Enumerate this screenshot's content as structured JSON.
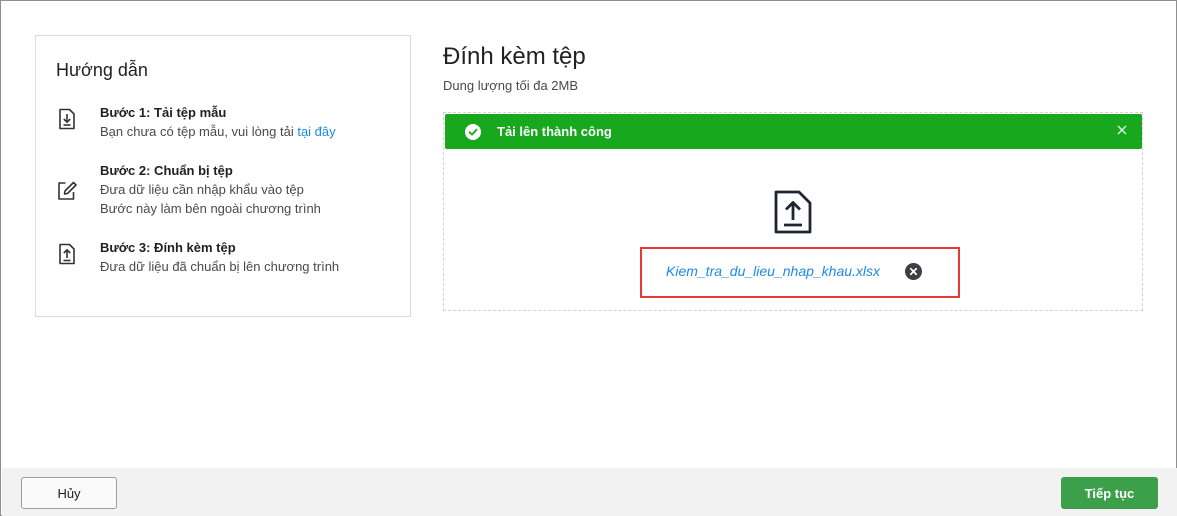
{
  "guide": {
    "title": "Hướng dẫn",
    "steps": [
      {
        "icon": "download-file-icon",
        "title": "Bước 1: Tải tệp mẫu",
        "line1_prefix": "Bạn chưa có tệp mẫu, vui lòng tải ",
        "line1_link": "tại đây"
      },
      {
        "icon": "edit-icon",
        "title": "Bước 2: Chuẩn bị tệp",
        "line1": "Đưa dữ liệu cần nhập khẩu vào tệp",
        "line2": "Bước này làm bên ngoài chương trình"
      },
      {
        "icon": "upload-file-icon",
        "title": "Bước 3: Đính kèm tệp",
        "line1": "Đưa dữ liệu đã chuẩn bị lên chương trình"
      }
    ]
  },
  "attach": {
    "title": "Đính kèm tệp",
    "subtitle": "Dung lượng tối đa 2MB",
    "banner_message": "Tải lên thành công",
    "file_name": "Kiem_tra_du_lieu_nhap_khau.xlsx"
  },
  "footer": {
    "cancel_label": "Hủy",
    "next_label": "Tiếp tục"
  },
  "colors": {
    "success": "#18a81e",
    "primary_button": "#3c9f49",
    "link": "#1e88e5",
    "highlight_border": "#e53935"
  }
}
